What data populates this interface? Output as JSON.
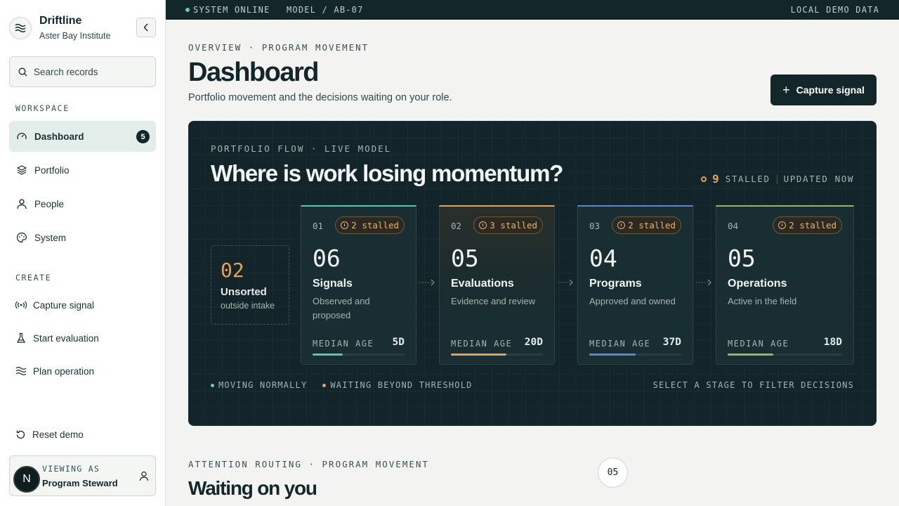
{
  "app": {
    "name": "Driftline",
    "org": "Aster Bay Institute"
  },
  "sidebar": {
    "search_placeholder": "Search records",
    "workspace_label": "WORKSPACE",
    "nav": [
      {
        "label": "Dashboard",
        "icon": "gauge-icon",
        "badge": "5",
        "active": true
      },
      {
        "label": "Portfolio",
        "icon": "layers-icon"
      },
      {
        "label": "People",
        "icon": "person-icon"
      },
      {
        "label": "System",
        "icon": "palette-icon"
      }
    ],
    "create_label": "CREATE",
    "create": [
      {
        "label": "Capture signal",
        "icon": "broadcast-icon"
      },
      {
        "label": "Start evaluation",
        "icon": "flask-icon"
      },
      {
        "label": "Plan operation",
        "icon": "waves-icon"
      }
    ],
    "reset_label": "Reset demo",
    "viewing": {
      "label": "VIEWING AS",
      "role": "Program Steward",
      "avatar_initial": "N"
    }
  },
  "topbar": {
    "status": "SYSTEM ONLINE",
    "model": "MODEL / AB-07",
    "data_source": "LOCAL DEMO DATA"
  },
  "header": {
    "eyebrow": "OVERVIEW · PROGRAM MOVEMENT",
    "title": "Dashboard",
    "subtitle": "Portfolio movement and the decisions waiting on your role.",
    "primary_button": "Capture signal"
  },
  "flow": {
    "eyebrow": "PORTFOLIO FLOW · LIVE MODEL",
    "title": "Where is work losing momentum?",
    "stalled_count": "9",
    "stalled_label": "STALLED",
    "updated": "UPDATED NOW",
    "unsorted": {
      "count": "02",
      "title": "Unsorted",
      "sub": "outside intake"
    },
    "stages": [
      {
        "idx": "01",
        "stalled": "2 stalled",
        "count": "06",
        "name": "Signals",
        "desc": "Observed and proposed",
        "age_label": "MEDIAN AGE",
        "age": "5D",
        "color": "#5cc3ad",
        "progress": 0.33
      },
      {
        "idx": "02",
        "stalled": "3 stalled",
        "count": "05",
        "name": "Evaluations",
        "desc": "Evidence and review",
        "age_label": "MEDIAN AGE",
        "age": "20D",
        "color": "#e2a25a",
        "progress": 0.6
      },
      {
        "idx": "03",
        "stalled": "2 stalled",
        "count": "04",
        "name": "Programs",
        "desc": "Approved and owned",
        "age_label": "MEDIAN AGE",
        "age": "37D",
        "color": "#5c86d1",
        "progress": 0.5
      },
      {
        "idx": "04",
        "stalled": "2 stalled",
        "count": "05",
        "name": "Operations",
        "desc": "Active in the field",
        "age_label": "MEDIAN AGE",
        "age": "18D",
        "color": "#8fb86a",
        "progress": 0.4
      }
    ],
    "legend_moving": "MOVING NORMALLY",
    "legend_waiting": "WAITING BEYOND THRESHOLD",
    "legend_hint": "SELECT A STAGE TO FILTER DECISIONS",
    "colors": {
      "moving": "#6fc7b4",
      "waiting": "#e2a25a"
    }
  },
  "attention": {
    "eyebrow": "ATTENTION ROUTING · PROGRAM MOVEMENT",
    "title": "Waiting on you",
    "badge": "05"
  }
}
